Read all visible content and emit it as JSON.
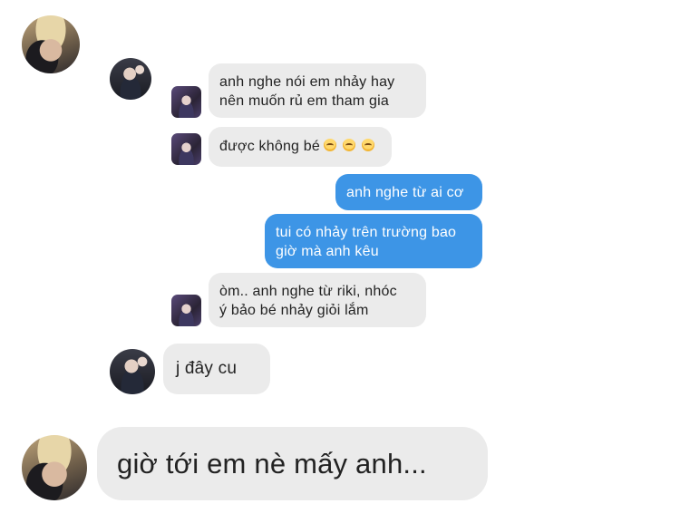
{
  "messages": [
    {
      "lines": [
        "anh nghe nói em nhảy hay",
        "nên muốn rủ em tham gia"
      ]
    },
    {
      "lines": [
        "được không bé"
      ],
      "emoji_count": 3,
      "emoji_name": "pleading-face-emoji"
    },
    {
      "lines": [
        "anh nghe từ ai cơ"
      ]
    },
    {
      "lines": [
        "tui có nhảy trên trường bao",
        "giờ mà anh kêu"
      ]
    },
    {
      "lines": [
        "òm.. anh nghe từ riki, nhóc",
        "ý bảo bé nhảy giỏi lắm"
      ]
    },
    {
      "lines": [
        "j đây cu"
      ]
    },
    {
      "lines": [
        "giờ tới em nè mấy anh..."
      ]
    }
  ],
  "colors": {
    "incoming_bubble": "#ebebeb",
    "outgoing_bubble": "#3d95e6",
    "incoming_text": "#222222",
    "outgoing_text": "#ffffff"
  }
}
